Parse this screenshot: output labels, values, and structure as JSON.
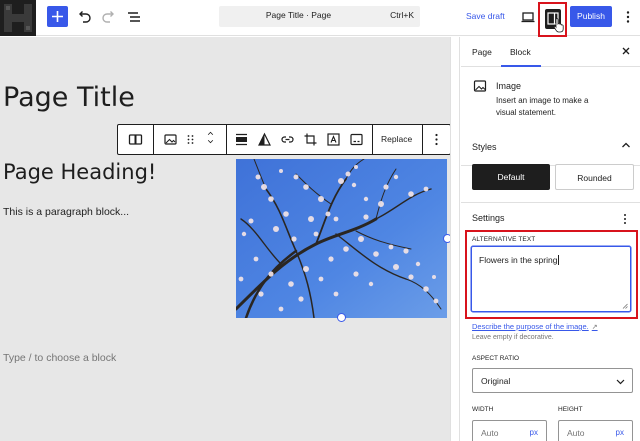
{
  "topbar": {
    "command_title": "Page Title · Page",
    "shortcut": "Ctrl+K",
    "save_draft": "Save draft",
    "publish": "Publish"
  },
  "editor": {
    "page_title": "Page Title",
    "heading": "Page Heading!",
    "paragraph": "This is a paragraph block...",
    "appender": "Type / to choose a block",
    "toolbar": {
      "replace": "Replace"
    }
  },
  "sidebar": {
    "tabs": [
      "Page",
      "Block"
    ],
    "active_tab": "Block",
    "block": {
      "name": "Image",
      "description": "Insert an image to make a visual statement."
    },
    "styles": {
      "title": "Styles",
      "options": [
        "Default",
        "Rounded"
      ],
      "selected": "Default"
    },
    "settings": {
      "title": "Settings",
      "alt_label": "ALTERNATIVE TEXT",
      "alt_value": "Flowers in the spring",
      "describe_link": "Describe the purpose of the image.",
      "help": "Leave empty if decorative.",
      "aspect_label": "ASPECT RATIO",
      "aspect_value": "Original",
      "width_label": "WIDTH",
      "height_label": "HEIGHT",
      "width_placeholder": "Auto",
      "height_placeholder": "Auto",
      "unit": "px"
    }
  },
  "colors": {
    "accent": "#3858e9",
    "highlight": "#d8131c",
    "dark": "#1e1e1e"
  }
}
